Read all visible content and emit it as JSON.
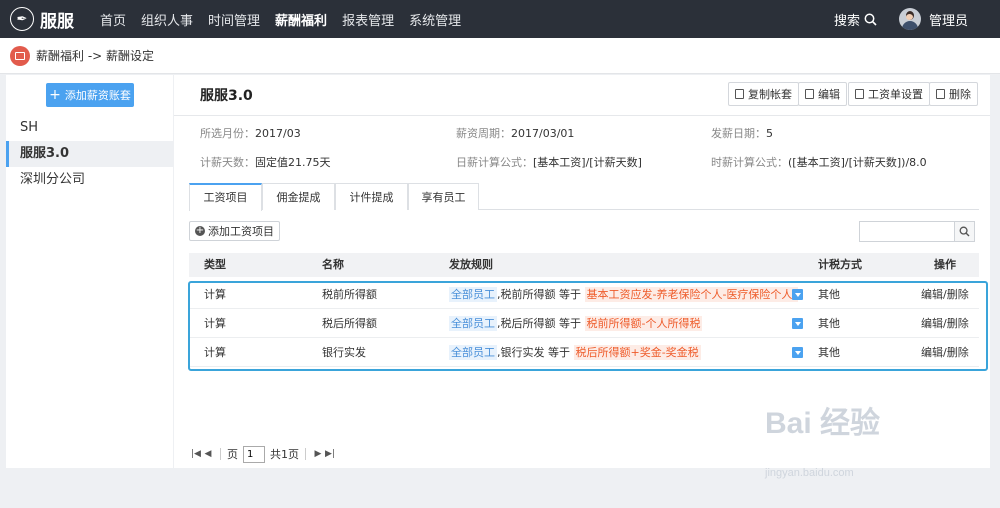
{
  "app": {
    "name": "服服",
    "logo_glyph": "✒"
  },
  "nav": {
    "items": [
      {
        "label": "首页",
        "active": false
      },
      {
        "label": "组织人事",
        "active": false
      },
      {
        "label": "时间管理",
        "active": false
      },
      {
        "label": "薪酬福利",
        "active": true
      },
      {
        "label": "报表管理",
        "active": false
      },
      {
        "label": "系统管理",
        "active": false
      }
    ],
    "search_label": "搜索",
    "user_name": "管理员"
  },
  "breadcrumb": {
    "text": "薪酬福利 -> 薪酬设定"
  },
  "sidebar": {
    "add_button": "添加薪资账套",
    "items": [
      {
        "label": "SH",
        "active": false
      },
      {
        "label": "服服3.0",
        "active": true
      },
      {
        "label": "深圳分公司",
        "active": false
      }
    ]
  },
  "main": {
    "title": "服服3.0",
    "toolbar": {
      "copy": "复制帐套",
      "edit": "编辑",
      "payslip": "工资单设置",
      "delete": "删除"
    },
    "info": {
      "month_label": "所选月份：",
      "month": "2017/03",
      "period_label": "薪资周期：",
      "period": "2017/03/01",
      "payday_label": "发薪日期：",
      "payday": "5",
      "days_label": "计薪天数：",
      "days": "固定值21.75天",
      "daily_label": "日薪计算公式：",
      "daily": "[基本工资]/[计薪天数]",
      "hourly_label": "时薪计算公式：",
      "hourly": "([基本工资]/[计薪天数])/8.0"
    },
    "tabs": [
      "工资项目",
      "佣金提成",
      "计件提成",
      "享有员工"
    ],
    "add_item": "添加工资项目",
    "table": {
      "headers": {
        "type": "类型",
        "name": "名称",
        "rule": "发放规则",
        "tax": "计税方式",
        "action": "操作"
      },
      "rows": [
        {
          "type": "计算",
          "name": "税前所得额",
          "scope": "全部员工",
          "rule_text": ",税前所得额 等于",
          "formula": "基本工资应发-养老保险个人-医疗保险个人-",
          "tax": "其他",
          "action": "编辑/删除"
        },
        {
          "type": "计算",
          "name": "税后所得额",
          "scope": "全部员工",
          "rule_text": ",税后所得额 等于",
          "formula": "税前所得额-个人所得税",
          "tax": "其他",
          "action": "编辑/删除"
        },
        {
          "type": "计算",
          "name": "银行实发",
          "scope": "全部员工",
          "rule_text": ",银行实发 等于",
          "formula": "税后所得额+奖金-奖金税",
          "tax": "其他",
          "action": "编辑/删除"
        }
      ]
    },
    "pager": {
      "page_label": "页",
      "page": "1",
      "total": "共1页"
    }
  },
  "watermark": {
    "brand": "Bai  经验",
    "url": "jingyan.baidu.com"
  },
  "colors": {
    "accent": "#4ba2f0",
    "topbar": "#2b3039",
    "highlight": "#3aa4da",
    "formula": "#ee5b2a"
  }
}
